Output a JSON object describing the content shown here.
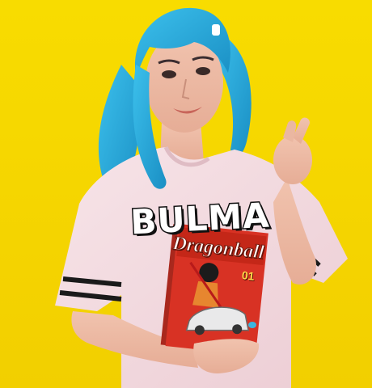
{
  "photo": {
    "background_color": "#f7d900",
    "wig_color": "#29a9d9",
    "shirt_color": "#f4dde2",
    "book_color": "#d83224"
  },
  "shirt": {
    "text": "BULMA"
  },
  "book": {
    "title": "Dragonball",
    "volume": "01"
  }
}
